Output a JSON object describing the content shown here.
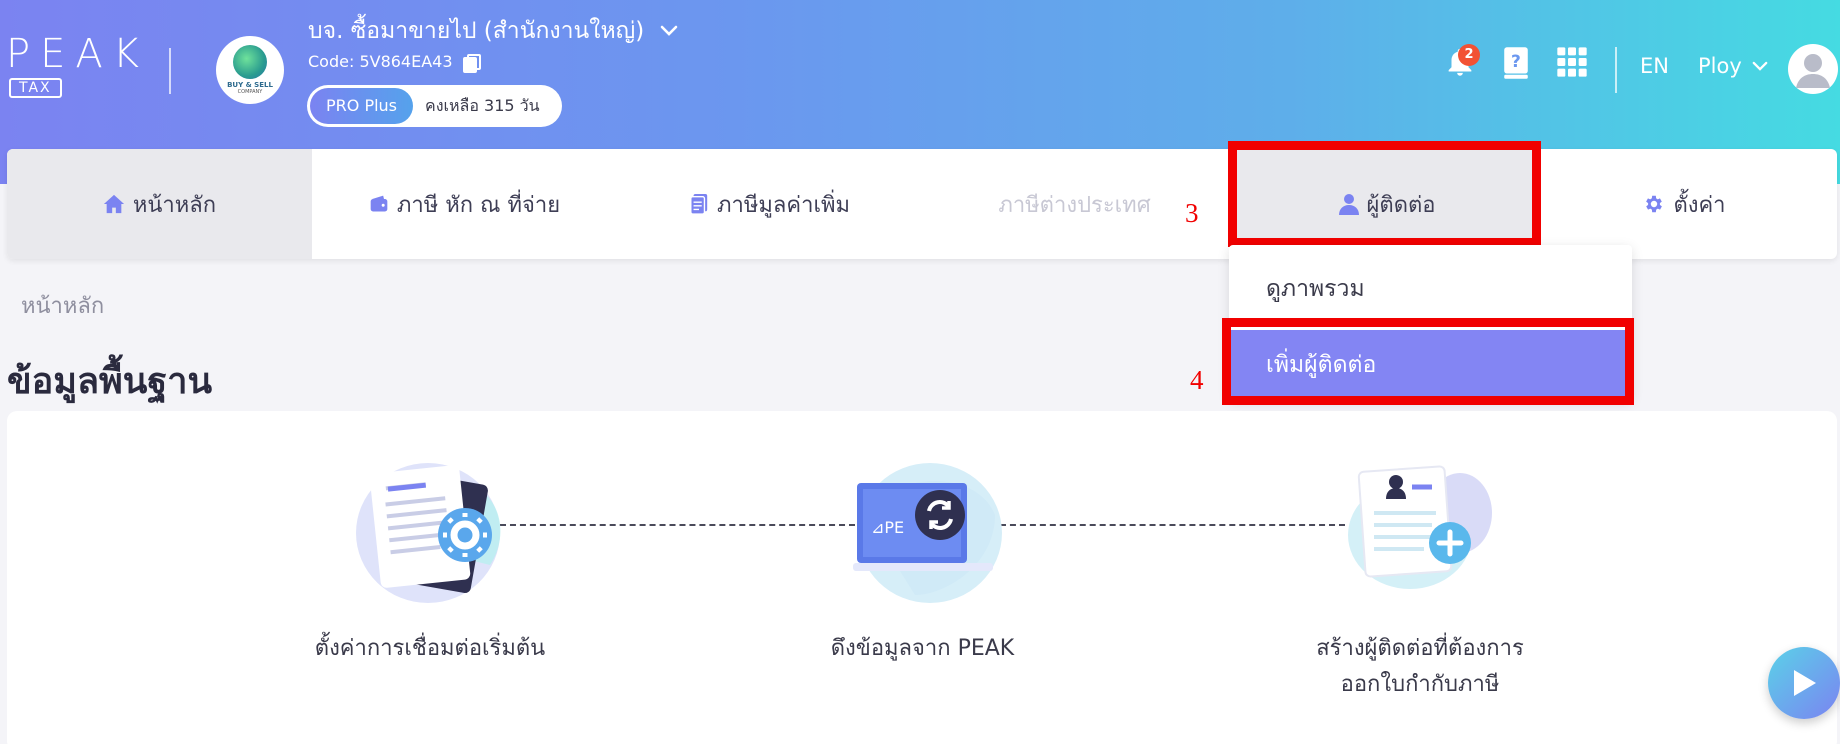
{
  "header": {
    "logo_text": "PEAK",
    "logo_sub": "TAX",
    "company": {
      "name": "บจ. ซื้อมาขายไป (สำนักงานใหญ่)",
      "logo_text": "BUY & SELL",
      "logo_sub": "COMPANY",
      "code": "Code: 5V864EA43",
      "plan": "PRO Plus",
      "days_left": "คงเหลือ 315 วัน"
    },
    "notification_count": "2",
    "language": "EN",
    "user_name": "Ploy",
    "icons": [
      "bell-icon",
      "help-book-icon",
      "apps-grid-icon",
      "chevron-down-icon",
      "user-avatar-icon"
    ]
  },
  "nav": {
    "items": [
      {
        "label": "หน้าหลัก",
        "icon": "home-icon"
      },
      {
        "label": "ภาษี หัก ณ ที่จ่าย",
        "icon": "wallet-icon"
      },
      {
        "label": "ภาษีมูลค่าเพิ่ม",
        "icon": "document-icon"
      },
      {
        "label": "ภาษีต่างประเทศ"
      },
      {
        "label": "ผู้ติดต่อ",
        "icon": "user-icon"
      },
      {
        "label": "ตั้งค่า",
        "icon": "gear-icon"
      }
    ]
  },
  "dropdown": {
    "items": [
      {
        "label": "ดูภาพรวม"
      },
      {
        "label": "เพิ่มผู้ติดต่อ"
      }
    ]
  },
  "annotations": {
    "step3": "3",
    "step4": "4",
    "highlight_color": "#f10000"
  },
  "main": {
    "breadcrumb": "หน้าหลัก",
    "title": "ข้อมูลพื้นฐาน",
    "steps": [
      {
        "label": "ตั้งค่าการเชื่อมต่อเริ่มต้น",
        "icon": "settings-document-icon"
      },
      {
        "label": "ดึงข้อมูลจาก PEAK",
        "icon": "sync-laptop-icon"
      },
      {
        "label_line1": "สร้างผู้ติดต่อที่ต้องการ",
        "label_line2": "ออกใบกำกับภาษี",
        "icon": "add-contact-document-icon"
      }
    ]
  },
  "colors": {
    "accent": "#7b83f1",
    "selected_menu": "#8385f3",
    "gradient_end": "#45dbe2"
  }
}
